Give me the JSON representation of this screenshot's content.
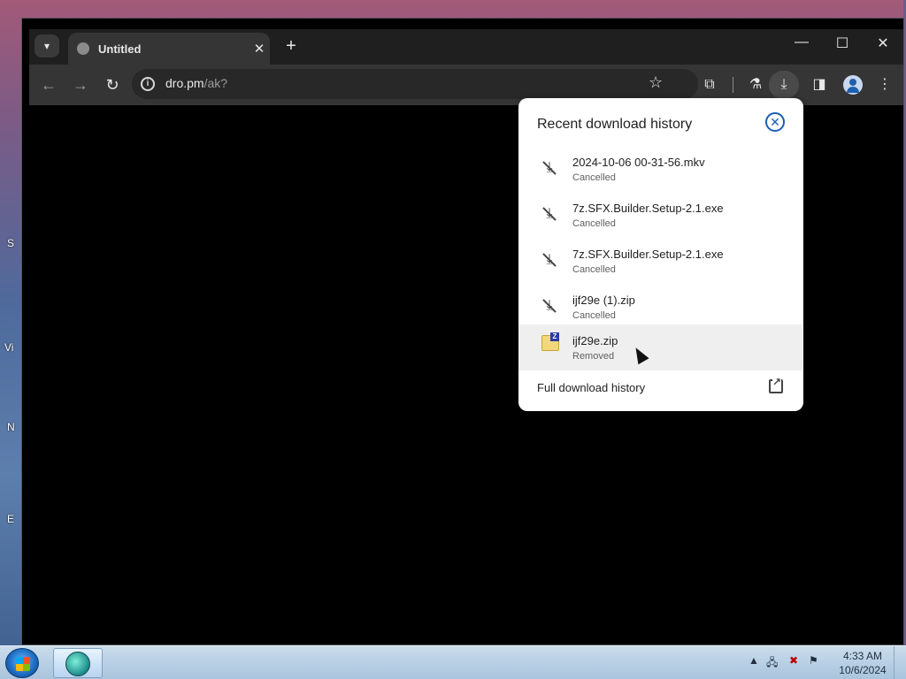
{
  "desktop": {
    "edge_letters": [
      "S",
      "Vi",
      "N",
      "E"
    ]
  },
  "browser": {
    "tab_title": "Untitled",
    "new_tab": "+",
    "url_host": "dro.pm",
    "url_path": "/ak?",
    "window_controls": {
      "minimize": "—",
      "maximize": "☐",
      "close": "✕"
    }
  },
  "downloads": {
    "title": "Recent download history",
    "items": [
      {
        "name": "2024-10-06 00-31-56.mkv",
        "status": "Cancelled",
        "icon": "download-cancelled-icon"
      },
      {
        "name": "7z.SFX.Builder.Setup-2.1.exe",
        "status": "Cancelled",
        "icon": "download-cancelled-icon"
      },
      {
        "name": "7z.SFX.Builder.Setup-2.1.exe",
        "status": "Cancelled",
        "icon": "download-cancelled-icon"
      },
      {
        "name": "ijf29e (1).zip",
        "status": "Cancelled",
        "icon": "download-cancelled-icon"
      },
      {
        "name": "ijf29e.zip",
        "status": "Removed",
        "icon": "zip-file-icon"
      }
    ],
    "full_history": "Full download history"
  },
  "taskbar": {
    "time": "4:33 AM",
    "date": "10/6/2024"
  },
  "colors": {
    "accent": "#1a5fb4",
    "browser_frame": "#1f1f1f",
    "toolbar": "#353535",
    "popup_bg": "#ffffff"
  }
}
